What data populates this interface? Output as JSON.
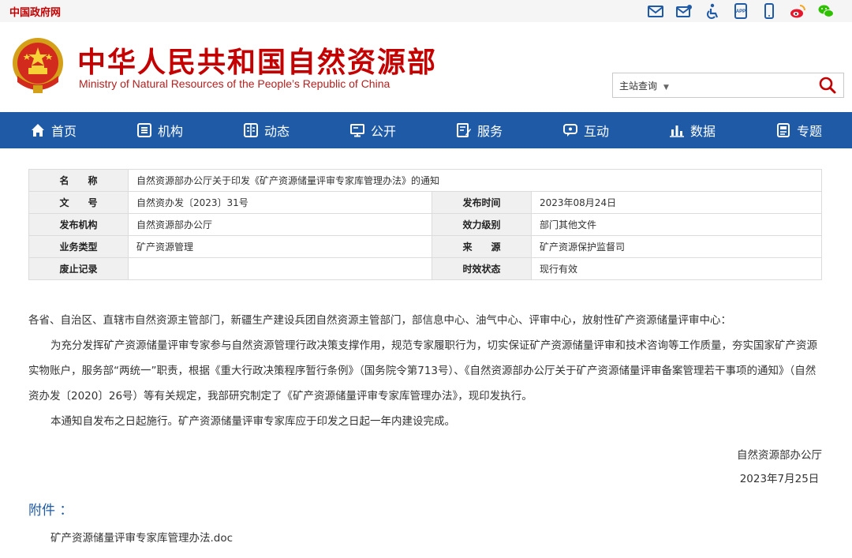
{
  "topbar": {
    "gov_link": "中国政府网",
    "icons": [
      "mail-icon",
      "subscribe-mail-icon",
      "accessibility-icon",
      "app-icon",
      "mobile-icon",
      "weibo-icon",
      "wechat-icon"
    ]
  },
  "header": {
    "title": "中华人民共和国自然资源部",
    "subtitle": "Ministry of Natural Resources of the People’s Republic of China",
    "search": {
      "scope_label": "主站查询",
      "query": ""
    }
  },
  "nav": [
    {
      "label": "首页",
      "icon": "home-icon"
    },
    {
      "label": "机构",
      "icon": "organization-icon"
    },
    {
      "label": "动态",
      "icon": "news-icon"
    },
    {
      "label": "公开",
      "icon": "disclosure-icon"
    },
    {
      "label": "服务",
      "icon": "service-icon"
    },
    {
      "label": "互动",
      "icon": "interaction-icon"
    },
    {
      "label": "数据",
      "icon": "data-chart-icon"
    },
    {
      "label": "专题",
      "icon": "topic-icon"
    }
  ],
  "meta": {
    "name_label": "名　　称",
    "name_value": "自然资源部办公厅关于印发《矿产资源储量评审专家库管理办法》的通知",
    "docno_label": "文　　号",
    "docno_value": "自然资办发〔2023〕31号",
    "pubtime_label": "发布时间",
    "pubtime_value": "2023年08月24日",
    "org_label": "发布机构",
    "org_value": "自然资源部办公厅",
    "level_label": "效力级别",
    "level_value": "部门其他文件",
    "type_label": "业务类型",
    "type_value": "矿产资源管理",
    "source_label": "来　　源",
    "source_value": "矿产资源保护监督司",
    "abolish_label": "废止记录",
    "abolish_value": "",
    "status_label": "时效状态",
    "status_value": "现行有效"
  },
  "body": {
    "salutation": "各省、自治区、直辖市自然资源主管部门，新疆生产建设兵团自然资源主管部门，部信息中心、油气中心、评审中心，放射性矿产资源储量评审中心：",
    "para1": "为充分发挥矿产资源储量评审专家参与自然资源管理行政决策支撑作用，规范专家履职行为，切实保证矿产资源储量评审和技术咨询等工作质量，夯实国家矿产资源实物账户，服务部“两统一”职责，根据《重大行政决策程序暂行条例》（国务院令第713号）、《自然资源部办公厅关于矿产资源储量评审备案管理若干事项的通知》（自然资办发〔2020〕26号）等有关规定，我部研究制定了《矿产资源储量评审专家库管理办法》，现印发执行。",
    "para2": "本通知自发布之日起施行。矿产资源储量评审专家库应于印发之日起一年内建设完成。",
    "signer": "自然资源部办公厅",
    "date": "2023年7月25日"
  },
  "attachments": {
    "title": "附件 ：",
    "files": [
      "矿产资源储量评审专家库管理办法.doc"
    ]
  },
  "colors": {
    "brand_red": "#c40000",
    "nav_blue": "#1e5aa6",
    "label_bg": "#f0f0f0"
  }
}
